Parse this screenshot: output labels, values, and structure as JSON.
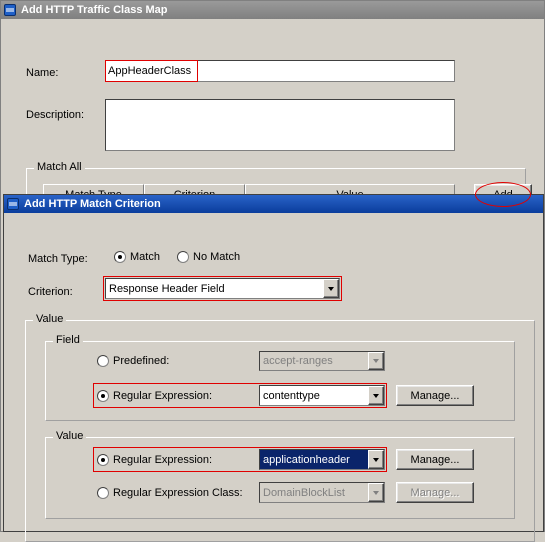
{
  "window_class_map": {
    "title": "Add HTTP Traffic Class Map",
    "icon": "app-window-icon",
    "name_label": "Name:",
    "name_value": "AppHeaderClass",
    "description_label": "Description:",
    "description_value": "",
    "match_all_group": "Match All",
    "table": {
      "columns": [
        "Match Type",
        "Criterion",
        "Value"
      ],
      "rows": []
    },
    "add_button": "Add"
  },
  "window_match_criterion": {
    "title": "Add HTTP Match Criterion",
    "icon": "app-window-icon",
    "match_type_label": "Match Type:",
    "match_radio": "Match",
    "no_match_radio": "No Match",
    "match_selected": "Match",
    "criterion_label": "Criterion:",
    "criterion_value": "Response Header Field",
    "value_group": "Value",
    "field_group": "Field",
    "field": {
      "predefined_label": "Predefined:",
      "predefined_value": "accept-ranges",
      "predefined_selected": false,
      "regex_label": "Regular Expression:",
      "regex_value": "contenttype",
      "regex_selected": true,
      "manage_button": "Manage..."
    },
    "value_inner_group": "Value",
    "value": {
      "regex_label": "Regular Expression:",
      "regex_value": "applicationheader",
      "regex_selected": true,
      "manage_button": "Manage...",
      "regex_class_label": "Regular Expression Class:",
      "regex_class_value": "DomainBlockList",
      "regex_class_selected": false,
      "manage_class_button": "Manage..."
    }
  },
  "colors": {
    "annotation": "#e00000",
    "active_title": "#0a3d9c",
    "inactive_title": "#808080",
    "dialog_face": "#d4d0c8",
    "selection": "#0a246a"
  }
}
